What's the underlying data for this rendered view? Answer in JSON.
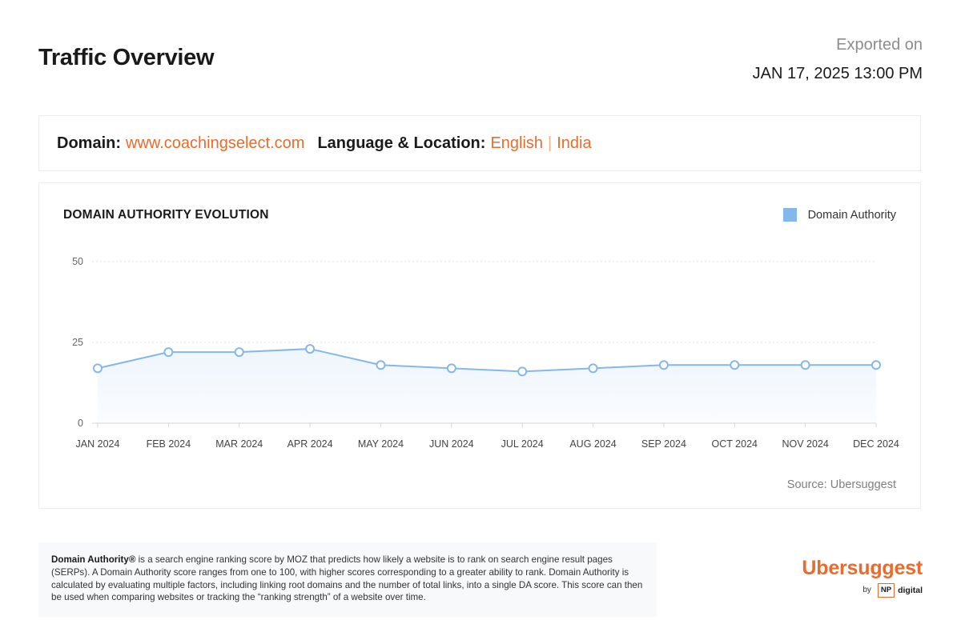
{
  "header": {
    "title": "Traffic Overview",
    "export_label": "Exported on",
    "export_date": "JAN 17, 2025 13:00 PM"
  },
  "domain_info": {
    "domain_label": "Domain:",
    "domain_value": "www.coachingselect.com",
    "location_label": "Language & Location:",
    "language": "English",
    "separator": "|",
    "location": "India"
  },
  "chart_data": {
    "type": "line",
    "title": "DOMAIN AUTHORITY EVOLUTION",
    "categories": [
      "JAN 2024",
      "FEB 2024",
      "MAR 2024",
      "APR 2024",
      "MAY 2024",
      "JUN 2024",
      "JUL 2024",
      "AUG 2024",
      "SEP 2024",
      "OCT 2024",
      "NOV 2024",
      "DEC 2024"
    ],
    "series": [
      {
        "name": "Domain Authority",
        "values": [
          17,
          22,
          22,
          23,
          18,
          17,
          16,
          17,
          18,
          18,
          18,
          18
        ],
        "color": "#84b7ea"
      }
    ],
    "ylim": [
      0,
      50
    ],
    "yticks": [
      0,
      25,
      50
    ],
    "grid": true,
    "legend": "top-right",
    "area_fill": true,
    "source": "Source: Ubersuggest"
  },
  "footnote": {
    "term": "Domain Authority®",
    "text": " is a search engine ranking score by MOZ that predicts how likely a website is to rank on search engine result pages (SERPs). A Domain Authority score ranges from one to 100, with higher scores corresponding to a greater ability to rank. Domain Authority is calculated by evaluating multiple factors, including linking root domains and the number of total links, into a single DA score. This score can then be used when comparing websites or tracking the “ranking strength” of a website over time."
  },
  "brand": {
    "name": "Ubersuggest",
    "by": "by",
    "np": "NP",
    "digital": "digital"
  },
  "colors": {
    "accent": "#ec6a2c",
    "series": "#84b7ea"
  }
}
